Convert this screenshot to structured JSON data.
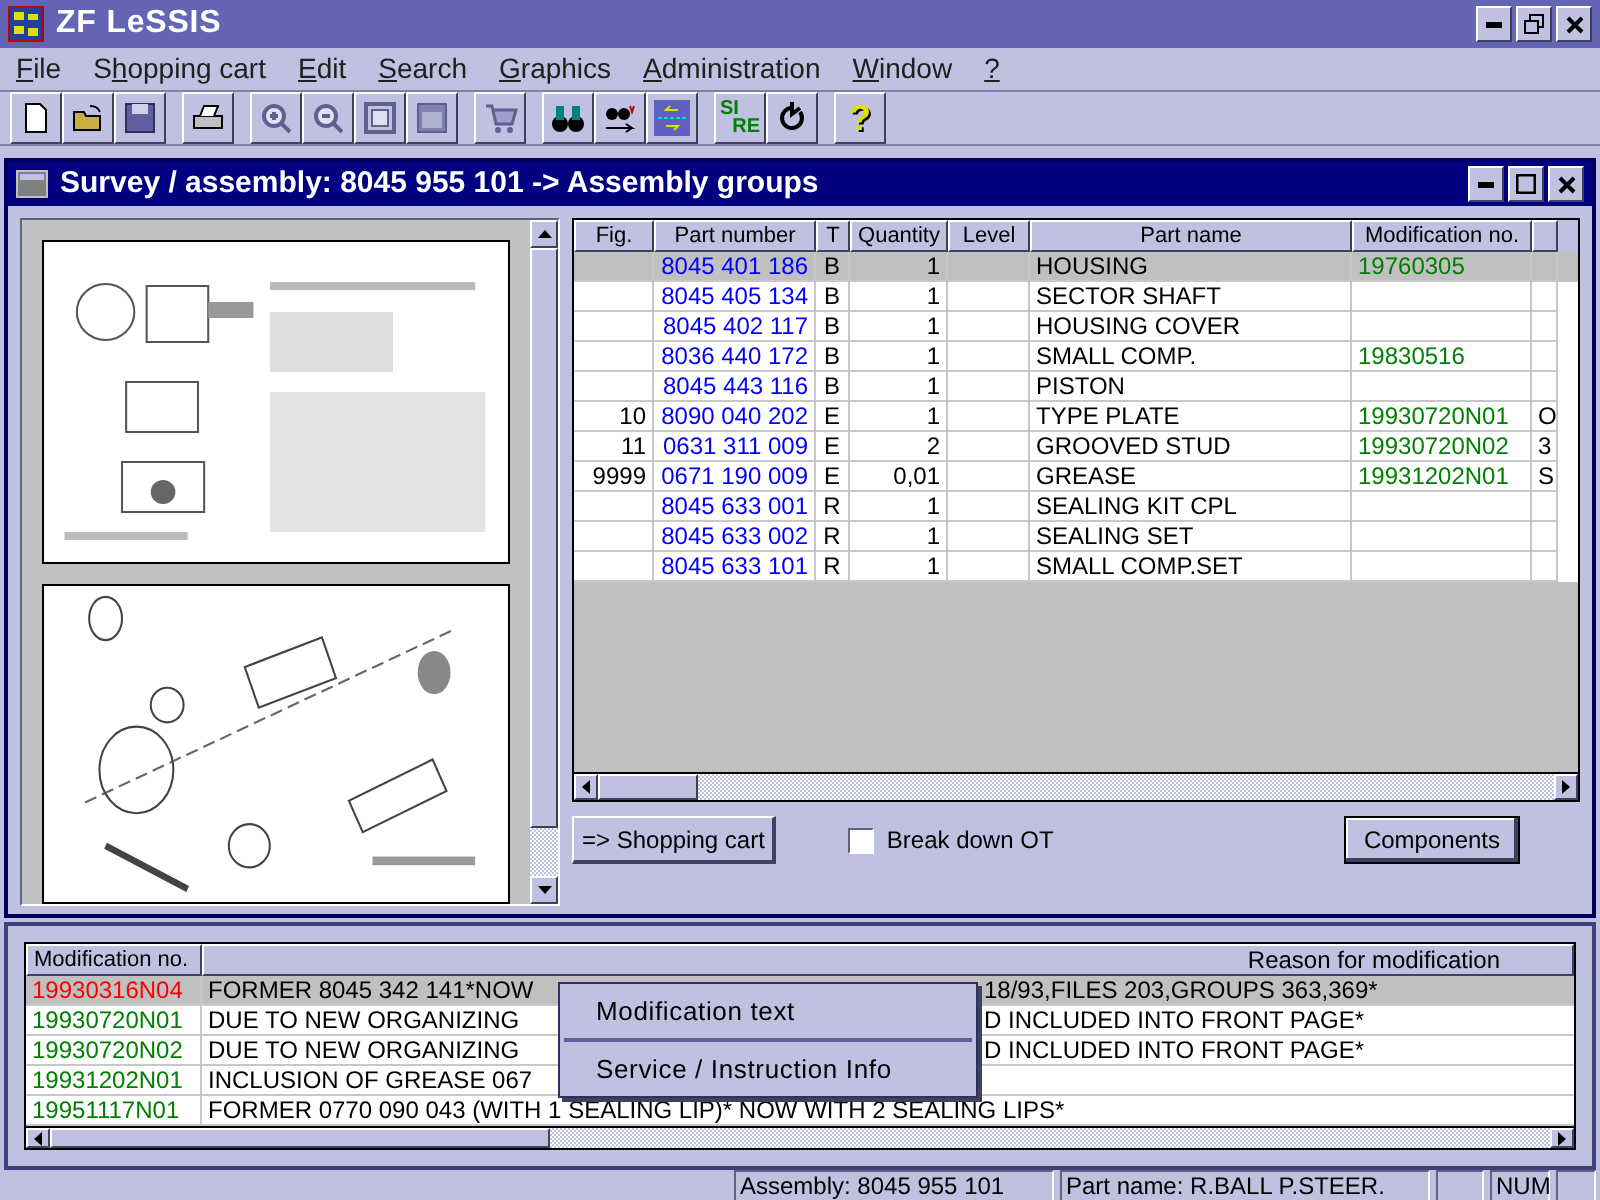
{
  "window": {
    "title": "ZF LeSSIS"
  },
  "menu": [
    {
      "key": "F",
      "after": "ile"
    },
    {
      "before": "S",
      "key": "h",
      "after": "opping cart"
    },
    {
      "key": "E",
      "after": "dit"
    },
    {
      "key": "S",
      "after": "earch"
    },
    {
      "key": "G",
      "after": "raphics"
    },
    {
      "key": "A",
      "after": "dministration"
    },
    {
      "key": "W",
      "after": "indow"
    },
    {
      "key": "?"
    }
  ],
  "toolbar_groups": [
    [
      {
        "kind": "new"
      },
      {
        "kind": "open"
      },
      {
        "kind": "save"
      }
    ],
    [
      {
        "kind": "print"
      }
    ],
    [
      {
        "kind": "zoom-in"
      },
      {
        "kind": "zoom-out"
      },
      {
        "kind": "fit"
      },
      {
        "kind": "frame"
      }
    ],
    [
      {
        "kind": "cart"
      }
    ],
    [
      {
        "kind": "binoculars"
      },
      {
        "kind": "find-next"
      },
      {
        "kind": "swap"
      }
    ],
    [
      {
        "kind": "letters",
        "top": "SI",
        "bottom": "RE"
      },
      {
        "kind": "refresh"
      }
    ],
    [
      {
        "kind": "help",
        "label": "?"
      }
    ]
  ],
  "child_window": {
    "title": "Survey / assembly: 8045 955 101 -> Assembly groups"
  },
  "parts_table": {
    "columns": [
      "Fig.",
      "Part number",
      "T",
      "Quantity",
      "Level",
      "Part name",
      "Modification no."
    ],
    "rows": [
      {
        "fig": "",
        "part_number": "8045 401 186",
        "t": "B",
        "quantity": "1",
        "part_name": "HOUSING",
        "modification": "19760305",
        "column_8": "",
        "selected": true
      },
      {
        "fig": "",
        "part_number": "8045 405 134",
        "t": "B",
        "quantity": "1",
        "part_name": "SECTOR SHAFT",
        "modification": "",
        "column_8": "",
        "selected": false
      },
      {
        "fig": "",
        "part_number": "8045 402 117",
        "t": "B",
        "quantity": "1",
        "part_name": "HOUSING COVER",
        "modification": "",
        "column_8": "",
        "selected": false
      },
      {
        "fig": "",
        "part_number": "8036 440 172",
        "t": "B",
        "quantity": "1",
        "part_name": "SMALL COMP.",
        "modification": "19830516",
        "column_8": "",
        "selected": false
      },
      {
        "fig": "",
        "part_number": "8045 443 116",
        "t": "B",
        "quantity": "1",
        "part_name": "PISTON",
        "modification": "",
        "column_8": "",
        "selected": false
      },
      {
        "fig": "10",
        "part_number": "8090 040 202",
        "t": "E",
        "quantity": "1",
        "part_name": "TYPE PLATE",
        "modification": "19930720N01",
        "column_8": "O",
        "selected": false
      },
      {
        "fig": "11",
        "part_number": "0631 311 009",
        "t": "E",
        "quantity": "2",
        "part_name": "GROOVED STUD",
        "modification": "19930720N02",
        "column_8": "3",
        "selected": false
      },
      {
        "fig": "9999",
        "part_number": "0671 190 009",
        "t": "E",
        "quantity": "0,01",
        "part_name": "GREASE",
        "modification": "19931202N01",
        "column_8": "S",
        "selected": false
      },
      {
        "fig": "",
        "part_number": "8045 633 001",
        "t": "R",
        "quantity": "1",
        "part_name": "SEALING KIT CPL",
        "modification": "",
        "column_8": "",
        "selected": false
      },
      {
        "fig": "",
        "part_number": "8045 633 002",
        "t": "R",
        "quantity": "1",
        "part_name": "SEALING SET",
        "modification": "",
        "column_8": "",
        "selected": false
      },
      {
        "fig": "",
        "part_number": "8045 633 101",
        "t": "R",
        "quantity": "1",
        "part_name": "SMALL COMP.SET",
        "modification": "",
        "column_8": "",
        "selected": false
      }
    ]
  },
  "shopping_cart_button": "=> Shopping cart",
  "break_down": {
    "label": "Break down OT",
    "checked": false
  },
  "components_button": "Components",
  "modifications_table": {
    "columns": [
      "Modification no.",
      "Reason for modification"
    ],
    "rows": [
      {
        "modification": "19930316N04",
        "color": "#ff0000",
        "reason_parts": [
          "FORMER 8045 342 141*NOW",
          "18/93,FILES 203,GROUPS 363,369*"
        ],
        "selected": true
      },
      {
        "modification": "19930720N01",
        "color": "#008000",
        "reason_parts": [
          "DUE TO NEW ORGANIZING",
          "D INCLUDED INTO FRONT PAGE*"
        ],
        "selected": false
      },
      {
        "modification": "19930720N02",
        "color": "#008000",
        "reason_parts": [
          "DUE TO NEW ORGANIZING",
          "D INCLUDED INTO FRONT PAGE*"
        ],
        "selected": false
      },
      {
        "modification": "19931202N01",
        "color": "#008000",
        "reason_parts": [
          "INCLUSION OF GREASE 067"
        ],
        "selected": false
      },
      {
        "modification": "19951117N01",
        "color": "#008000",
        "reason": "FORMER 0770 090 043 (WITH 1 SEALING LIP)* NOW WITH 2 SEALING LIPS*",
        "selected": false
      }
    ]
  },
  "context_menu": [
    "Modification text",
    "Service / Instruction Info"
  ],
  "status_bar": {
    "assembly": "Assembly: 8045 955 101",
    "part_name": "Part name: R.BALL P.STEER.",
    "num": "NUM"
  }
}
